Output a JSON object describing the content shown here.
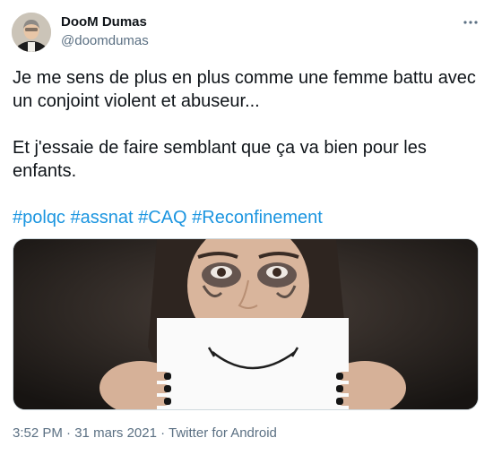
{
  "author": {
    "display_name": "DooM Dumas",
    "handle": "@doomdumas"
  },
  "tweet": {
    "line1": "Je me sens de plus en plus comme une femme battu avec un conjoint violent et abuseur...",
    "line2": "Et j'essaie de faire semblant que ça va bien pour les enfants.",
    "hashtags": [
      "#polqc",
      "#assnat",
      "#CAQ",
      "#Reconfinement"
    ]
  },
  "meta": {
    "time": "3:52 PM",
    "separator": " · ",
    "date": "31 mars 2021",
    "source": "Twitter for Android"
  },
  "icons": {
    "more": "more-horizontal-icon"
  },
  "colors": {
    "link": "#1b95e0",
    "secondary_text": "#5b7083",
    "primary_text": "#0f1419"
  }
}
